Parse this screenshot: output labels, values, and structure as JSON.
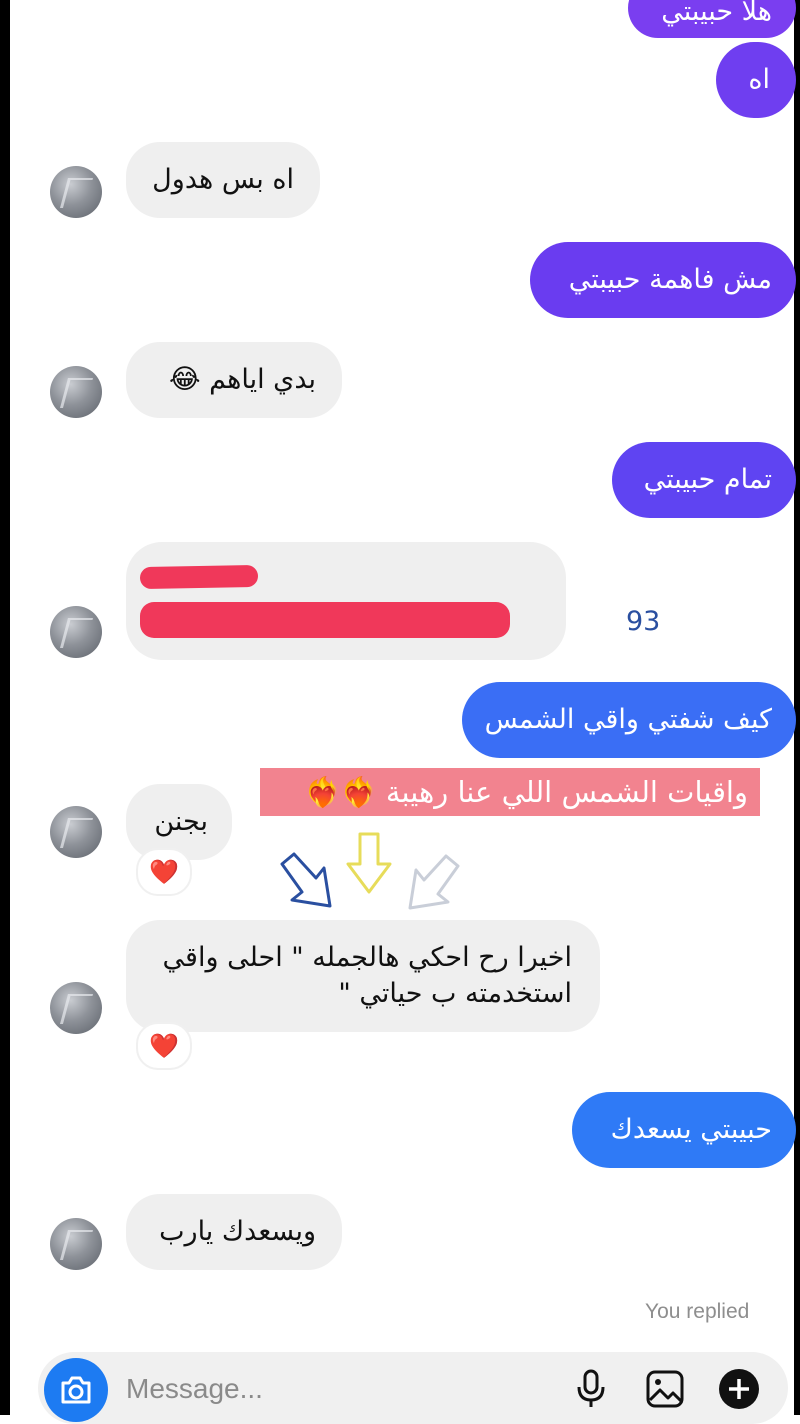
{
  "messages": [
    {
      "text": "هلا حبيبتي"
    },
    {
      "text": "اه"
    },
    {
      "text": "اه بس هدول"
    },
    {
      "text": "مش فاهمة حبيبتي"
    },
    {
      "text": "بدي اياهم 😂"
    },
    {
      "text": "تمام حبيبتي"
    },
    {
      "text": "93"
    },
    {
      "text": "كيف شفتي واقي الشمس"
    },
    {
      "text": "بجنن",
      "reaction": "❤️"
    },
    {
      "text_line1": "اخيرا رح احكي هالجمله \" احلى واقي",
      "text_line2": "استخدمته ب حياتي \"",
      "reaction": "❤️"
    },
    {
      "text": "حبيبتي يسعدك"
    },
    {
      "text": "ويسعدك يارب"
    }
  ],
  "caption": "واقيات الشمس اللي عنا رهيبة ❤️‍🔥❤️‍🔥",
  "status": "You replied",
  "composer": {
    "placeholder": "Message..."
  },
  "colors": {
    "outgoing_purple": "#6a3cf0",
    "outgoing_indigo": "#5849f2",
    "outgoing_blue": "#3a6ef5",
    "outgoing_bright_blue": "#2f7af6",
    "incoming": "#efefef",
    "caption_bg": "#f2838f",
    "camera_button": "#1d7bf2"
  },
  "icons": [
    "camera-icon",
    "microphone-icon",
    "gallery-icon",
    "plus-icon"
  ]
}
